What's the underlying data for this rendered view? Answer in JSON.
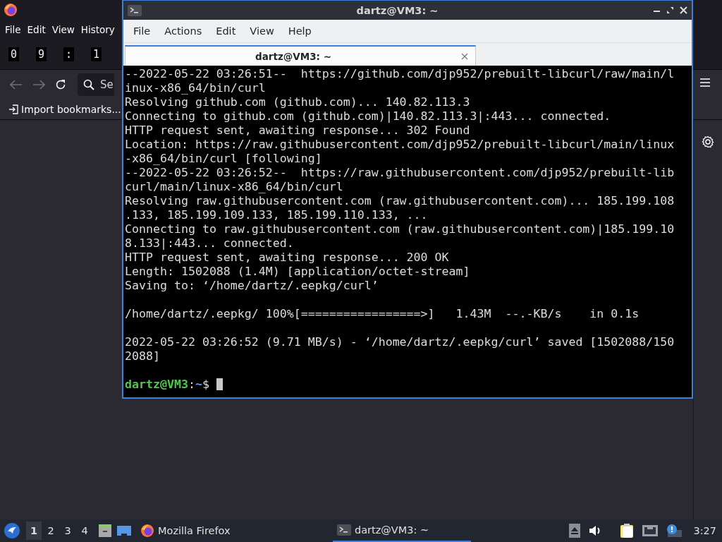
{
  "firefox": {
    "menu": [
      "File",
      "Edit",
      "View",
      "History"
    ],
    "clock_digits": [
      "0",
      "9",
      ":",
      "1"
    ],
    "search": {
      "placeholder": "Se"
    },
    "bookmarks": [
      "Import bookmarks..."
    ]
  },
  "terminal": {
    "title": "dartz@VM3: ~",
    "menu": [
      "File",
      "Actions",
      "Edit",
      "View",
      "Help"
    ],
    "tabs": [
      {
        "label": "dartz@VM3: ~",
        "selected": true
      }
    ],
    "output": [
      [
        "--2022-05-22 03:26:51--  https://github.com/djp952/prebuilt-libcurl/raw/main/l",
        "inux-x86_64/bin/curl",
        "Resolving github.com (github.com)... 140.82.113.3",
        "Connecting to github.com (github.com)|140.82.113.3|:443... connected.",
        "HTTP request sent, awaiting response... 302 Found",
        "Location: https://raw.githubusercontent.com/djp952/prebuilt-libcurl/main/linux",
        "-x86_64/bin/curl [following]",
        "--2022-05-22 03:26:52--  https://raw.githubusercontent.com/djp952/prebuilt-lib",
        "curl/main/linux-x86_64/bin/curl",
        "Resolving raw.githubusercontent.com (raw.githubusercontent.com)... 185.199.108",
        ".133, 185.199.109.133, 185.199.110.133, ...",
        "Connecting to raw.githubusercontent.com (raw.githubusercontent.com)|185.199.10",
        "8.133|:443... connected.",
        "HTTP request sent, awaiting response... 200 OK",
        "Length: 1502088 (1.4M) [application/octet-stream]",
        "Saving to: ‘/home/dartz/.eepkg/curl’"
      ],
      [
        "/home/dartz/.eepkg/ 100%[=================>]   1.43M  --.-KB/s    in 0.1s"
      ],
      [
        "2022-05-22 03:26:52 (9.71 MB/s) - ‘/home/dartz/.eepkg/curl’ saved [1502088/150",
        "2088]"
      ]
    ],
    "prompt": {
      "user": "dartz@VM3",
      "separator": ":",
      "path": "~",
      "symbol": "$"
    }
  },
  "taskbar": {
    "desktops": [
      {
        "label": "1",
        "selected": true
      },
      {
        "label": "2",
        "selected": false
      },
      {
        "label": "3",
        "selected": false
      },
      {
        "label": "4",
        "selected": false
      }
    ],
    "tasks": [
      {
        "label": "Mozilla Firefox",
        "kind": "firefox",
        "selected": false
      },
      {
        "label": "dartz@VM3: ~",
        "kind": "terminal",
        "selected": true
      }
    ],
    "clock": "3:27"
  }
}
